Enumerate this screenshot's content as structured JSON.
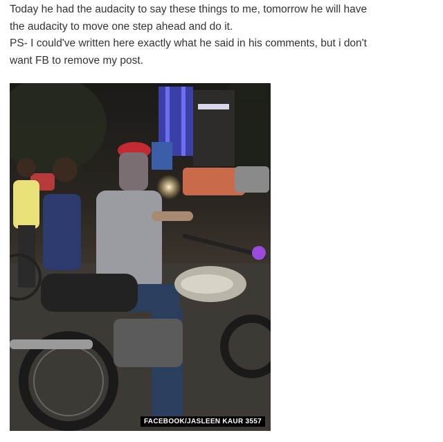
{
  "post": {
    "lines": [
      "Today he had the audacity to say these things to me, tomorrow he will have",
      "the audacity to move one step ahead and do it.",
      "PS- I could've written here exactly what he said in his comments, but i don't",
      "want FB to remove my post."
    ]
  },
  "photo": {
    "subject": "man on motorcycle at night street"
  },
  "credit": {
    "label": "FACEBOOK/JASLEEN KAUR 3557"
  }
}
